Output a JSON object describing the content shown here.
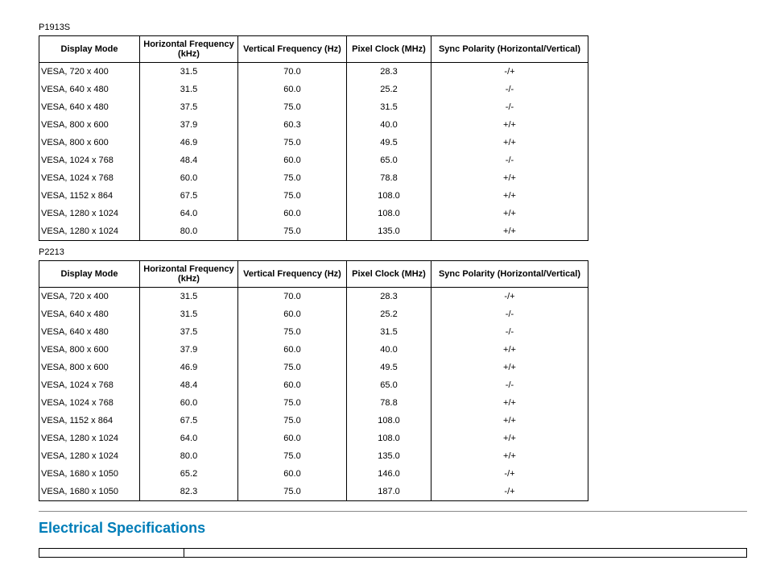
{
  "labels": {
    "t1": "P1913S",
    "t2": "P2213"
  },
  "headers": {
    "mode": "Display Mode",
    "hfreq": "Horizontal Frequency (kHz)",
    "vfreq": "Vertical Frequency (Hz)",
    "pclk": "Pixel Clock (MHz)",
    "sync": "Sync Polarity (Horizontal/Vertical)"
  },
  "table1": [
    {
      "mode": "VESA, 720 x 400",
      "hfreq": "31.5",
      "vfreq": "70.0",
      "pclk": "28.3",
      "sync": "-/+"
    },
    {
      "mode": "VESA, 640 x 480",
      "hfreq": "31.5",
      "vfreq": "60.0",
      "pclk": "25.2",
      "sync": "-/-"
    },
    {
      "mode": "VESA, 640 x 480",
      "hfreq": "37.5",
      "vfreq": "75.0",
      "pclk": "31.5",
      "sync": "-/-"
    },
    {
      "mode": "VESA, 800 x 600",
      "hfreq": "37.9",
      "vfreq": "60.3",
      "pclk": "40.0",
      "sync": "+/+"
    },
    {
      "mode": "VESA, 800 x 600",
      "hfreq": "46.9",
      "vfreq": "75.0",
      "pclk": "49.5",
      "sync": "+/+"
    },
    {
      "mode": "VESA, 1024 x 768",
      "hfreq": "48.4",
      "vfreq": "60.0",
      "pclk": "65.0",
      "sync": "-/-"
    },
    {
      "mode": "VESA, 1024 x 768",
      "hfreq": "60.0",
      "vfreq": "75.0",
      "pclk": "78.8",
      "sync": "+/+"
    },
    {
      "mode": "VESA, 1152 x 864",
      "hfreq": "67.5",
      "vfreq": "75.0",
      "pclk": "108.0",
      "sync": "+/+"
    },
    {
      "mode": "VESA, 1280 x 1024",
      "hfreq": "64.0",
      "vfreq": "60.0",
      "pclk": "108.0",
      "sync": "+/+"
    },
    {
      "mode": "VESA, 1280 x 1024",
      "hfreq": "80.0",
      "vfreq": "75.0",
      "pclk": "135.0",
      "sync": "+/+"
    }
  ],
  "table2": [
    {
      "mode": "VESA, 720 x 400",
      "hfreq": "31.5",
      "vfreq": "70.0",
      "pclk": "28.3",
      "sync": "-/+"
    },
    {
      "mode": "VESA, 640 x 480",
      "hfreq": "31.5",
      "vfreq": "60.0",
      "pclk": "25.2",
      "sync": "-/-"
    },
    {
      "mode": "VESA, 640 x 480",
      "hfreq": "37.5",
      "vfreq": "75.0",
      "pclk": "31.5",
      "sync": "-/-"
    },
    {
      "mode": "VESA, 800 x 600",
      "hfreq": "37.9",
      "vfreq": "60.0",
      "pclk": "40.0",
      "sync": "+/+"
    },
    {
      "mode": "VESA, 800 x 600",
      "hfreq": "46.9",
      "vfreq": "75.0",
      "pclk": "49.5",
      "sync": "+/+"
    },
    {
      "mode": "VESA, 1024 x 768",
      "hfreq": "48.4",
      "vfreq": "60.0",
      "pclk": "65.0",
      "sync": "-/-"
    },
    {
      "mode": "VESA, 1024 x 768",
      "hfreq": "60.0",
      "vfreq": "75.0",
      "pclk": "78.8",
      "sync": "+/+"
    },
    {
      "mode": "VESA, 1152 x 864",
      "hfreq": "67.5",
      "vfreq": "75.0",
      "pclk": "108.0",
      "sync": "+/+"
    },
    {
      "mode": "VESA, 1280 x 1024",
      "hfreq": "64.0",
      "vfreq": "60.0",
      "pclk": "108.0",
      "sync": "+/+"
    },
    {
      "mode": "VESA, 1280 x 1024",
      "hfreq": "80.0",
      "vfreq": "75.0",
      "pclk": "135.0",
      "sync": "+/+"
    },
    {
      "mode": "VESA, 1680 x 1050",
      "hfreq": "65.2",
      "vfreq": "60.0",
      "pclk": "146.0",
      "sync": "-/+"
    },
    {
      "mode": "VESA, 1680 x 1050",
      "hfreq": "82.3",
      "vfreq": "75.0",
      "pclk": "187.0",
      "sync": "-/+"
    }
  ],
  "section_heading": "Electrical Specifications"
}
